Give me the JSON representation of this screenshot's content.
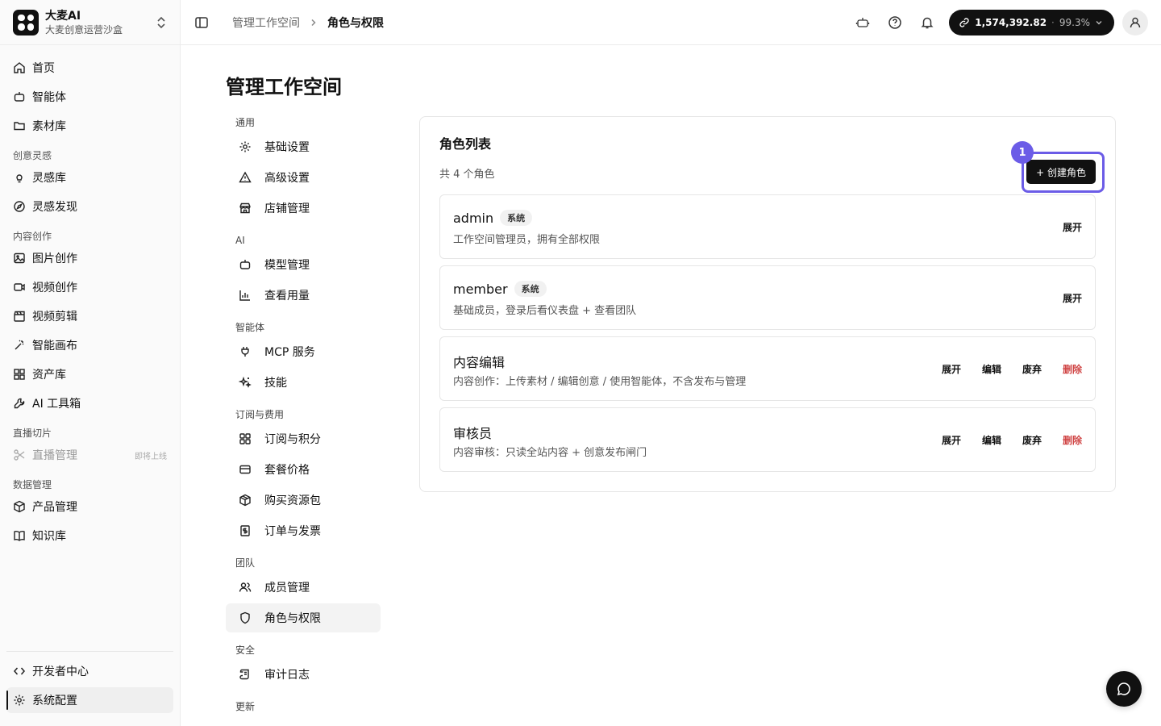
{
  "brand": {
    "name": "大麦AI",
    "subtitle": "大麦创意运营沙盒"
  },
  "sidebar": {
    "items": [
      {
        "label": "首页",
        "icon": "home-icon"
      },
      {
        "label": "智能体",
        "icon": "bot-icon"
      },
      {
        "label": "素材库",
        "icon": "folder-icon"
      }
    ],
    "section_inspiration": "创意灵感",
    "inspiration_items": [
      {
        "label": "灵感库",
        "icon": "lightbulb-icon"
      },
      {
        "label": "灵感发现",
        "icon": "compass-icon"
      }
    ],
    "section_content": "内容创作",
    "content_items": [
      {
        "label": "图片创作",
        "icon": "image-icon"
      },
      {
        "label": "视频创作",
        "icon": "video-icon"
      },
      {
        "label": "视频剪辑",
        "icon": "clapper-icon"
      },
      {
        "label": "智能画布",
        "icon": "wand-icon"
      },
      {
        "label": "资产库",
        "icon": "grid-icon"
      },
      {
        "label": "AI 工具箱",
        "icon": "wrench-icon"
      }
    ],
    "section_live": "直播切片",
    "live_items": [
      {
        "label": "直播管理",
        "icon": "scissors-icon",
        "badge": "即将上线"
      }
    ],
    "section_data": "数据管理",
    "data_items": [
      {
        "label": "产品管理",
        "icon": "box-icon"
      },
      {
        "label": "知识库",
        "icon": "book-icon"
      }
    ],
    "bottom_items": [
      {
        "label": "开发者中心",
        "icon": "code-icon"
      },
      {
        "label": "系统配置",
        "icon": "gear-icon"
      }
    ]
  },
  "topbar": {
    "breadcrumb": [
      "管理工作空间",
      "角色与权限"
    ],
    "credits": {
      "value": "1,574,392.82",
      "percent": "99.3%"
    }
  },
  "page": {
    "title": "管理工作空间"
  },
  "subnav": {
    "general": {
      "title": "通用",
      "items": [
        "基础设置",
        "高级设置",
        "店铺管理"
      ]
    },
    "ai": {
      "title": "AI",
      "items": [
        "模型管理",
        "查看用量"
      ]
    },
    "agent": {
      "title": "智能体",
      "items": [
        "MCP 服务",
        "技能"
      ]
    },
    "billing": {
      "title": "订阅与费用",
      "items": [
        "订阅与积分",
        "套餐价格",
        "购买资源包",
        "订单与发票"
      ]
    },
    "team": {
      "title": "团队",
      "items": [
        "成员管理",
        "角色与权限"
      ]
    },
    "security": {
      "title": "安全",
      "items": [
        "审计日志"
      ]
    },
    "update": {
      "title": "更新"
    }
  },
  "roles": {
    "title": "角色列表",
    "count_text": "共 4 个角色",
    "create_label": "+ 创建角色",
    "highlight_badge": "1",
    "list": [
      {
        "name": "admin",
        "tag": "系统",
        "desc": "工作空间管理员，拥有全部权限",
        "actions": [
          "展开"
        ]
      },
      {
        "name": "member",
        "tag": "系统",
        "desc": "基础成员，登录后看仪表盘 + 查看团队",
        "actions": [
          "展开"
        ]
      },
      {
        "name": "内容编辑",
        "desc": "内容创作：上传素材 / 编辑创意 / 使用智能体，不含发布与管理",
        "actions": [
          "展开",
          "编辑",
          "废弃",
          "删除"
        ]
      },
      {
        "name": "审核员",
        "desc": "内容审核：只读全站内容 + 创意发布闸门",
        "actions": [
          "展开",
          "编辑",
          "废弃",
          "删除"
        ]
      }
    ]
  }
}
